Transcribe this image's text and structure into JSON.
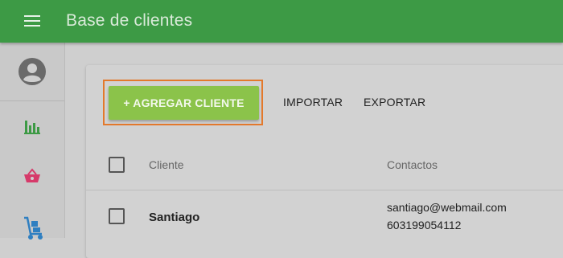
{
  "topbar": {
    "title": "Base de clientes",
    "menu_icon": "hamburger-menu-icon",
    "color": "#3d9a45"
  },
  "sidebar": {
    "avatar_icon": "account-circle-icon",
    "items": [
      {
        "icon": "bar-chart-icon",
        "color": "#3d9a45"
      },
      {
        "icon": "shopping-basket-icon",
        "color": "#d63a6a"
      },
      {
        "icon": "hand-truck-icon",
        "color": "#2f7fc1"
      }
    ]
  },
  "toolbar": {
    "add_label": "+ AGREGAR CLIENTE",
    "import_label": "IMPORTAR",
    "export_label": "EXPORTAR",
    "add_color": "#8bc34a",
    "highlight_color": "#e3792c"
  },
  "table": {
    "headers": {
      "client": "Cliente",
      "contacts": "Contactos"
    },
    "rows": [
      {
        "name": "Santiago",
        "email": "santiago@webmail.com",
        "phone": "603199054112"
      }
    ]
  }
}
